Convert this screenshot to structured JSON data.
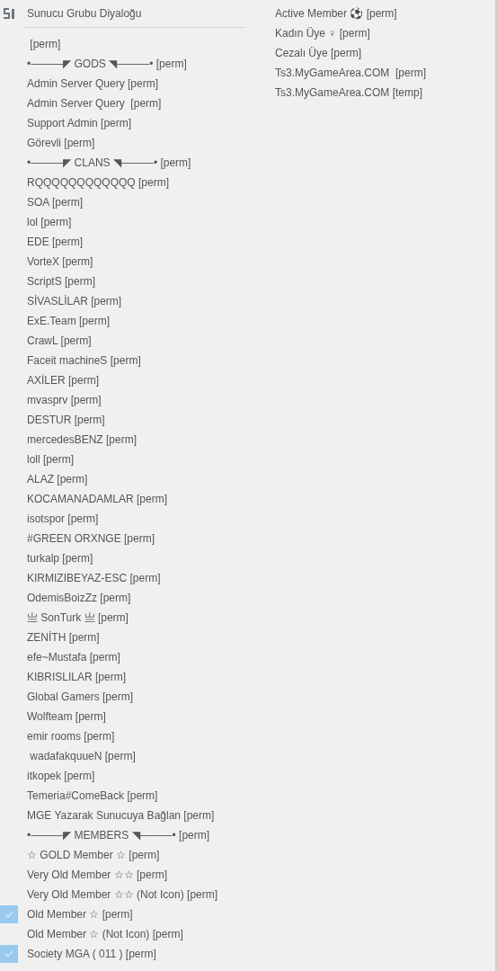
{
  "menu": {
    "title": "Sunucu Grubu Diyaloğu",
    "columns": [
      {
        "items": [
          {
            "label": " [perm]",
            "checked": false
          },
          {
            "label": "•———◤ GODS ◥———• [perm]",
            "checked": false
          },
          {
            "label": "Admin Server Query [perm]",
            "checked": false
          },
          {
            "label": "Admin Server Query  [perm]",
            "checked": false
          },
          {
            "label": "Support Admin [perm]",
            "checked": false
          },
          {
            "label": "Görevli [perm]",
            "checked": false
          },
          {
            "label": "•———◤ CLANS ◥———• [perm]",
            "checked": false
          },
          {
            "label": "RQQQQQQQQQQQQ [perm]",
            "checked": false
          },
          {
            "label": "SOA [perm]",
            "checked": false
          },
          {
            "label": "lol [perm]",
            "checked": false
          },
          {
            "label": "EDE [perm]",
            "checked": false
          },
          {
            "label": "VorteX [perm]",
            "checked": false
          },
          {
            "label": "ScriptS [perm]",
            "checked": false
          },
          {
            "label": "SİVASLİLAR [perm]",
            "checked": false
          },
          {
            "label": "ExE.Team [perm]",
            "checked": false
          },
          {
            "label": "CrawL [perm]",
            "checked": false
          },
          {
            "label": "Faceit machineS [perm]",
            "checked": false
          },
          {
            "label": "AXİLER [perm]",
            "checked": false
          },
          {
            "label": "mvasprv [perm]",
            "checked": false
          },
          {
            "label": "DESTUR [perm]",
            "checked": false
          },
          {
            "label": "mercedesBENZ [perm]",
            "checked": false
          },
          {
            "label": "loll [perm]",
            "checked": false
          },
          {
            "label": "ALAZ [perm]",
            "checked": false
          },
          {
            "label": "KOCAMANADAMLAR [perm]",
            "checked": false
          },
          {
            "label": "isotspor [perm]",
            "checked": false
          },
          {
            "label": "#GREEN ORXNGE [perm]",
            "checked": false
          },
          {
            "label": "turkalp [perm]",
            "checked": false
          },
          {
            "label": "KIRMIZIBEYAZ-ESC [perm]",
            "checked": false
          },
          {
            "label": "OdemisBoizZz [perm]",
            "checked": false
          },
          {
            "label": "亗 SonTurk 亗 [perm]",
            "checked": false
          },
          {
            "label": "ZENİTH [perm]",
            "checked": false
          },
          {
            "label": "efe~Mustafa [perm]",
            "checked": false
          },
          {
            "label": "KIBRISLILAR [perm]",
            "checked": false
          },
          {
            "label": "Global Gamers [perm]",
            "checked": false
          },
          {
            "label": "Wolfteam [perm]",
            "checked": false
          },
          {
            "label": "emir rooms [perm]",
            "checked": false
          },
          {
            "label": " wadafakquueN [perm]",
            "checked": false
          },
          {
            "label": "itkopek [perm]",
            "checked": false
          },
          {
            "label": "Temeria#ComeBack [perm]",
            "checked": false
          },
          {
            "label": "MGE Yazarak Sunucuya Bağlan [perm]",
            "checked": false
          },
          {
            "label": "•———◤ MEMBERS ◥———• [perm]",
            "checked": false
          },
          {
            "label": "☆ GOLD Member ☆ [perm]",
            "checked": false
          },
          {
            "label": "Very Old Member ☆☆ [perm]",
            "checked": false
          },
          {
            "label": "Very Old Member ☆☆ (Not Icon) [perm]",
            "checked": false
          },
          {
            "label": "Old Member ☆ [perm]",
            "checked": true
          },
          {
            "label": "Old Member ☆ (Not Icon) [perm]",
            "checked": false
          },
          {
            "label": "Society MGA ( 011 ) [perm]",
            "checked": true
          }
        ]
      },
      {
        "items": [
          {
            "label": "Active Member ⚽ [perm]",
            "checked": false
          },
          {
            "label": "Kadın Üye ♀ [perm]",
            "checked": false
          },
          {
            "label": "Cezalı Üye [perm]",
            "checked": false
          },
          {
            "label": "Ts3.MyGameArea.COM  [perm]",
            "checked": false
          },
          {
            "label": "Ts3.MyGameArea.COM [temp]",
            "checked": false
          }
        ]
      }
    ]
  }
}
